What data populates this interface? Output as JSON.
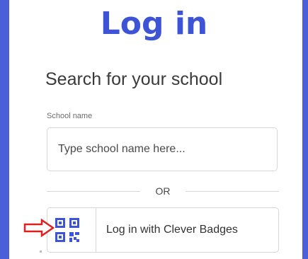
{
  "page": {
    "title": "Log in"
  },
  "search": {
    "heading": "Search for your school",
    "field_label": "School name",
    "placeholder": "Type school name here..."
  },
  "divider": {
    "text": "OR"
  },
  "badges_login": {
    "label": "Log in with Clever Badges",
    "icon": "qr-code-icon"
  },
  "annotation": {
    "icon": "red-arrow-icon",
    "color": "#e02020"
  },
  "colors": {
    "brand": "#3d54d6",
    "side_bars": "#4b5fd9"
  }
}
